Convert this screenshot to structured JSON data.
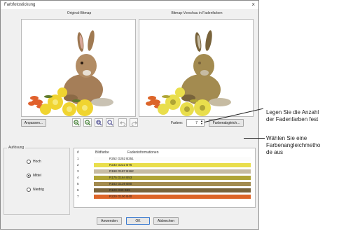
{
  "window": {
    "title": "Farbfotostickung",
    "close_glyph": "×"
  },
  "labels": {
    "original": "Original-Bitmap",
    "preview": "Bitmap-Vorschau in Fadenfarben"
  },
  "toolbar": {
    "anpassen": "Anpassen...",
    "farben_label": "Farben:",
    "farben_value": "7",
    "farbenabgleich": "Farbenabgleich...",
    "icons": [
      "zoom-in-icon",
      "zoom-out-icon",
      "zoom-fit-icon",
      "zoom-actual-icon",
      "undo-icon",
      "redo-icon"
    ]
  },
  "aufloesung": {
    "title": "Auflösung",
    "options": [
      {
        "label": "Hoch",
        "selected": false
      },
      {
        "label": "Mittel",
        "selected": true
      },
      {
        "label": "Niedrig",
        "selected": false
      }
    ]
  },
  "table": {
    "headers": [
      "#",
      "Bildfarbe",
      "Fadeninformationen"
    ],
    "rows": [
      {
        "num": "1",
        "info": "R252 G252 B251",
        "color": "#fcfcfb"
      },
      {
        "num": "2",
        "info": "R233 G222 B76",
        "color": "#e9de4c"
      },
      {
        "num": "3",
        "info": "R198 G187 B162",
        "color": "#c6bba2"
      },
      {
        "num": "4",
        "info": "R175 G164 B53",
        "color": "#afa435"
      },
      {
        "num": "5",
        "info": "R163 G139 B80",
        "color": "#a38b50"
      },
      {
        "num": "6",
        "info": "R120 G99 B59",
        "color": "#78633b"
      },
      {
        "num": "7",
        "info": "R220 G100 B40",
        "color": "#dc6428"
      }
    ]
  },
  "buttons": {
    "anwenden": "Anwenden",
    "ok": "OK",
    "abbrechen": "Abbrechen"
  },
  "annotations": [
    {
      "lines": [
        "Legen Sie die Anzahl",
        "der Fadenfarben fest"
      ]
    },
    {
      "lines": [
        "Wählen Sie eine",
        "Farbenangleichmetho",
        "de aus"
      ]
    }
  ]
}
